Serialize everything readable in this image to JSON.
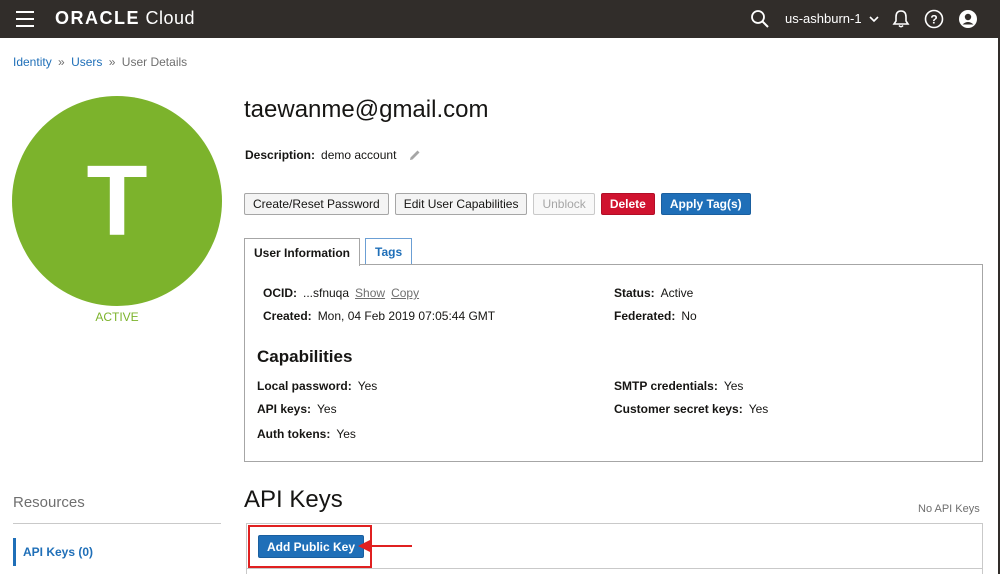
{
  "topbar": {
    "brand_bold": "ORACLE",
    "brand_light": " Cloud",
    "region": "us-ashburn-1"
  },
  "breadcrumb": {
    "items": [
      "Identity",
      "Users",
      "User Details"
    ],
    "separator": "»"
  },
  "user": {
    "avatar_letter": "T",
    "state": "ACTIVE",
    "email": "taewanme@gmail.com",
    "description_label": "Description:",
    "description": "demo account"
  },
  "actions": {
    "create_reset": "Create/Reset Password",
    "edit_caps": "Edit User Capabilities",
    "unblock": "Unblock",
    "delete": "Delete",
    "apply_tags": "Apply Tag(s)"
  },
  "tabs": {
    "user_info": "User Information",
    "tags": "Tags"
  },
  "info": {
    "ocid_label": "OCID:",
    "ocid_value": "...sfnuqa",
    "show": "Show",
    "copy": "Copy",
    "created_label": "Created:",
    "created_value": "Mon, 04 Feb 2019 07:05:44 GMT",
    "status_label": "Status:",
    "status_value": "Active",
    "federated_label": "Federated:",
    "federated_value": "No"
  },
  "capabilities": {
    "title": "Capabilities",
    "local_password_label": "Local password:",
    "local_password_value": "Yes",
    "api_keys_label": "API keys:",
    "api_keys_value": "Yes",
    "auth_tokens_label": "Auth tokens:",
    "auth_tokens_value": "Yes",
    "smtp_label": "SMTP credentials:",
    "smtp_value": "Yes",
    "customer_secret_label": "Customer secret keys:",
    "customer_secret_value": "Yes"
  },
  "resources": {
    "title": "Resources",
    "api_keys_item": "API Keys (0)"
  },
  "api_keys": {
    "title": "API Keys",
    "empty_text": "No API Keys",
    "add_button": "Add Public Key"
  },
  "colors": {
    "topbar": "#312d2a",
    "avatar": "#7cb32c",
    "link": "#1f6fb8",
    "danger": "#d0132f",
    "highlight": "#e02020"
  },
  "icons": [
    "hamburger-icon",
    "search-icon",
    "chevron-down-icon",
    "bell-icon",
    "help-icon",
    "user-profile-icon",
    "pencil-icon",
    "arrow-left-icon"
  ]
}
